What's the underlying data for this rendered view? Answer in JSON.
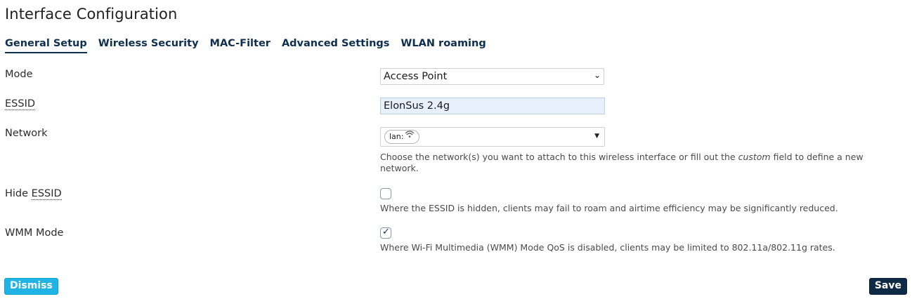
{
  "page": {
    "title": "Interface Configuration"
  },
  "tabs": [
    {
      "label": "General Setup",
      "active": true
    },
    {
      "label": "Wireless Security",
      "active": false
    },
    {
      "label": "MAC-Filter",
      "active": false
    },
    {
      "label": "Advanced Settings",
      "active": false
    },
    {
      "label": "WLAN roaming",
      "active": false
    }
  ],
  "form": {
    "mode": {
      "label": "Mode",
      "value": "Access Point"
    },
    "essid": {
      "label": "ESSID",
      "value": "ElonSus 2.4g"
    },
    "network": {
      "label": "Network",
      "chip": "lan:",
      "description_part1": "Choose the network(s) you want to attach to this wireless interface or fill out the ",
      "description_emph": "custom",
      "description_part2": " field to define a new network."
    },
    "hide_essid": {
      "label_prefix": "Hide ",
      "label_abbr": "ESSID",
      "checked": false,
      "description": "Where the ESSID is hidden, clients may fail to roam and airtime efficiency may be significantly reduced."
    },
    "wmm_mode": {
      "label": "WMM Mode",
      "checked": true,
      "description": "Where Wi-Fi Multimedia (WMM) Mode QoS is disabled, clients may be limited to 802.11a/802.11g rates."
    }
  },
  "buttons": {
    "dismiss": "Dismiss",
    "save": "Save"
  },
  "colors": {
    "accent_dark": "#0e2a44",
    "accent_light": "#20b4e6",
    "input_autofill_bg": "#e8f0fe"
  },
  "icons": {
    "select_chevron": "chevron-down-icon",
    "network_chip": "wifi-icon",
    "checkmark": "check-icon"
  }
}
